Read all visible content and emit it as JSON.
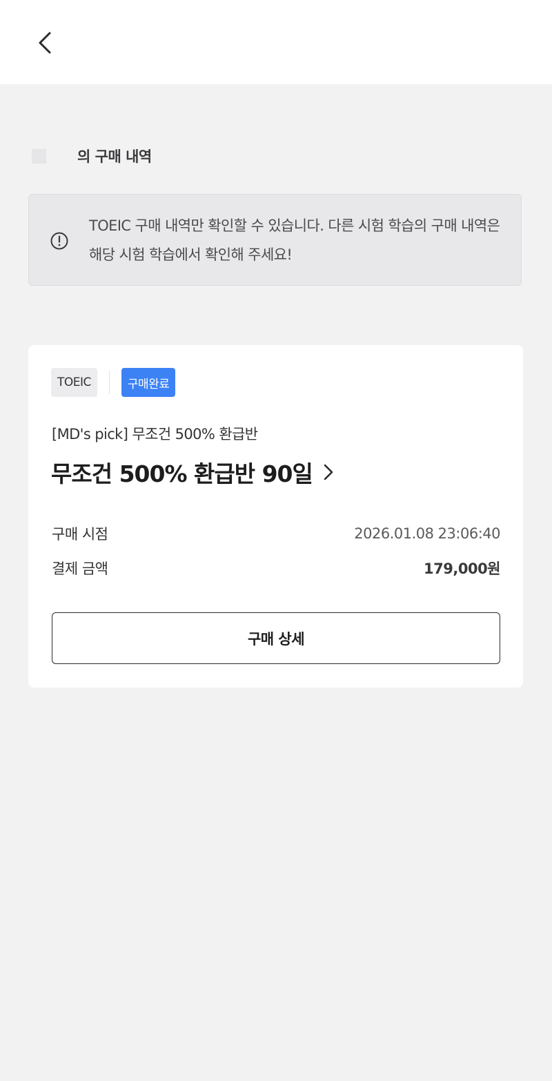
{
  "header": {
    "back_icon": "chevron-left-icon"
  },
  "section": {
    "title": "의 구매 내역"
  },
  "notice": {
    "icon": "alert-circle-icon",
    "text": "TOEIC 구매 내역만 확인할 수 있습니다. 다른 시험 학습의 구매 내역은 해당 시험 학습에서 확인해 주세요!"
  },
  "order": {
    "exam_tag": "TOEIC",
    "status": "구매완료",
    "status_color": "#3c82f5",
    "product_subtitle": "[MD's pick] 무조건 500% 환급반",
    "product_title": "무조건 500% 환급반 90일",
    "purchase_time_label": "구매 시점",
    "purchase_time_value": "2026.01.08 23:06:40",
    "amount_label": "결제 금액",
    "amount_value": "179,000원",
    "detail_button": "구매 상세"
  }
}
